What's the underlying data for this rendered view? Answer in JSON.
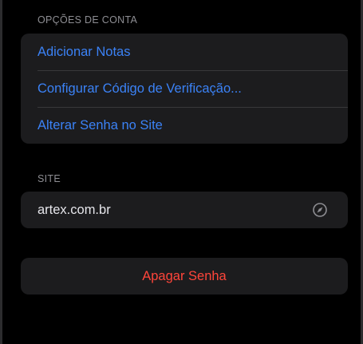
{
  "account_options": {
    "header": "OPÇÕES DE CONTA",
    "items": [
      {
        "label": "Adicionar Notas"
      },
      {
        "label": "Configurar Código de Verificação..."
      },
      {
        "label": "Alterar Senha no Site"
      }
    ]
  },
  "site": {
    "header": "SITE",
    "value": "artex.com.br",
    "icon": "compass-icon"
  },
  "delete": {
    "label": "Apagar Senha"
  },
  "colors": {
    "background": "#000000",
    "group_background": "#1c1c1e",
    "link": "#3b82f6",
    "destructive": "#ff453a",
    "header": "#8e8e93"
  }
}
